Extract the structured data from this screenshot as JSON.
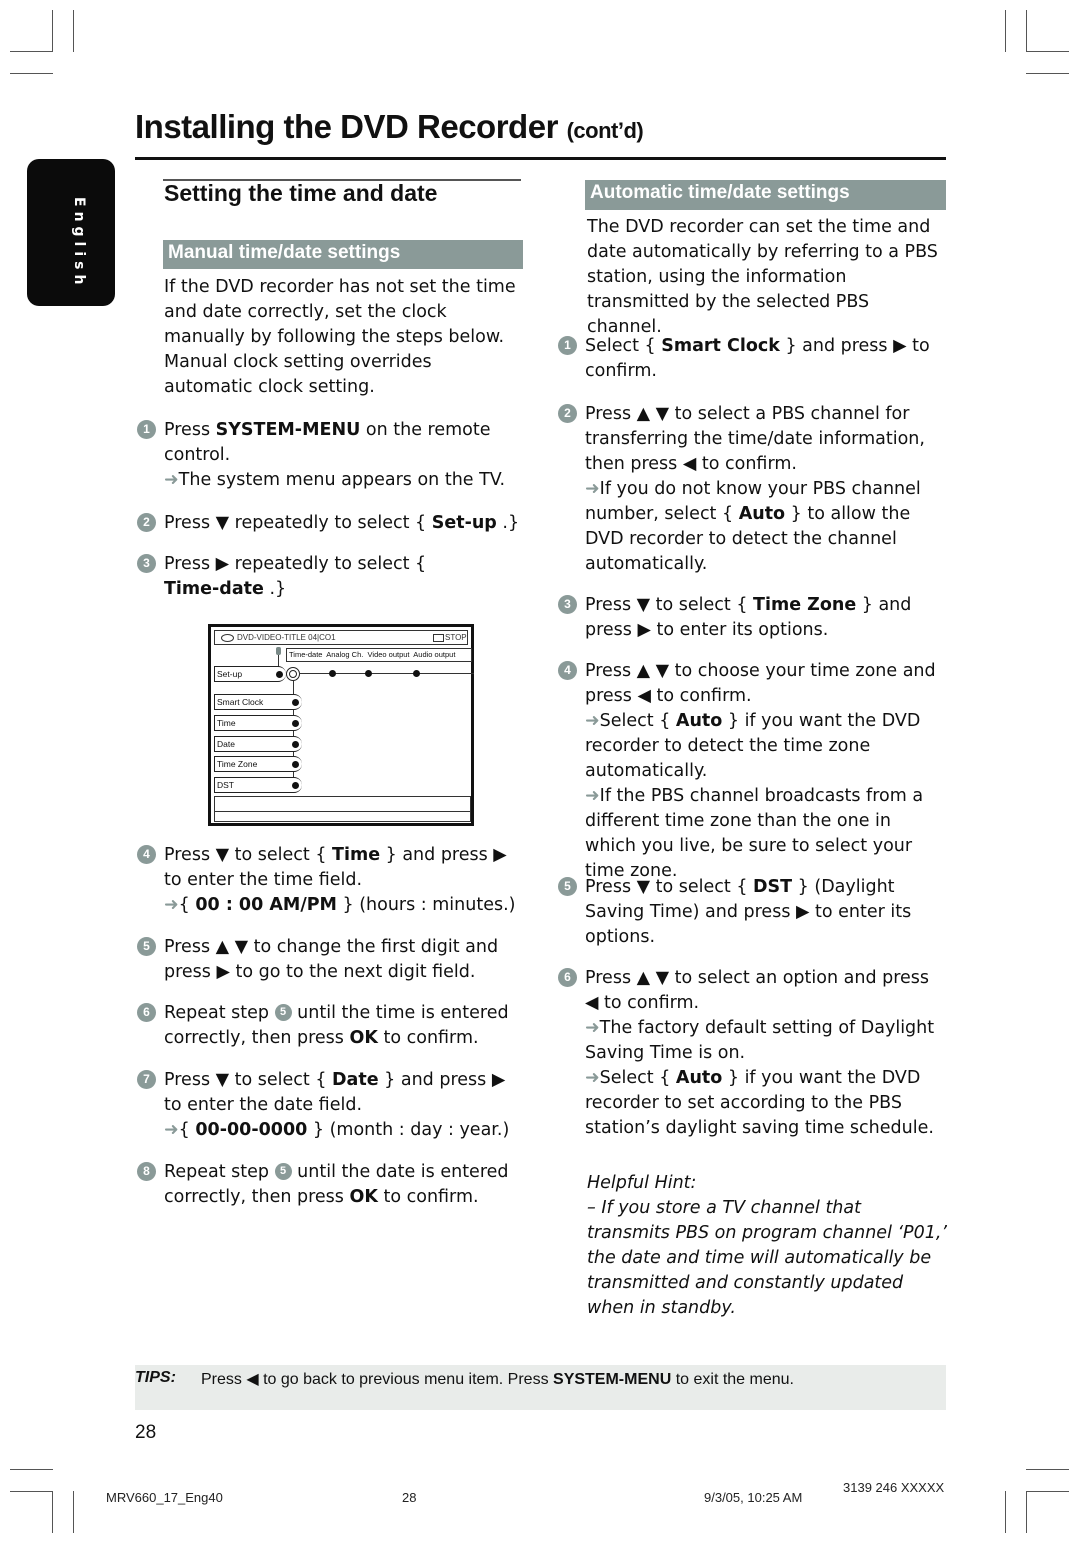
{
  "header": {
    "title": "Installing the DVD Recorder",
    "title_suffix": "(cont’d)",
    "language_tab": "English"
  },
  "left": {
    "section_title": "Setting the time and date",
    "subsection_title": "Manual time/date settings",
    "intro": "If the DVD recorder has not set the time and date correctly, set the clock manually by following the steps below. Manual clock setting overrides automatic clock setting.",
    "steps": [
      {
        "num": "1",
        "pre": "Press ",
        "bold": "SYSTEM-MENU",
        "post": " on the remote control.",
        "result": "The system menu appears on the TV."
      },
      {
        "num": "2",
        "pre": "Press ▼ repeatedly to select { ",
        "bold": "Set-up",
        "post": " .}"
      },
      {
        "num": "3",
        "pre": "Press ▶ repeatedly to select { ",
        "bold": "Time-date",
        "post": " .}"
      },
      {
        "num": "4",
        "pre": "Press ▼ to select { ",
        "bold": "Time",
        "post": " } and press ▶ to enter the time field.",
        "result_pre": "{ ",
        "result_bold": "00 : 00 AM/PM",
        "result_post": " } (hours : minutes.)"
      },
      {
        "num": "5",
        "text": "Press ▲ ▼ to change the first digit and press ▶ to go to the next digit field."
      },
      {
        "num": "6",
        "pre": "Repeat step ",
        "ref": "5",
        "mid": " until the time is entered correctly, then press ",
        "bold": "OK",
        "post": " to confirm."
      },
      {
        "num": "7",
        "pre": "Press ▼ to select { ",
        "bold": "Date",
        "post": " } and press ▶ to enter the date field.",
        "result_pre": "{ ",
        "result_bold": "00-00-0000",
        "result_post": " } (month : day : year.)"
      },
      {
        "num": "8",
        "pre": "Repeat step ",
        "ref": "5",
        "mid": " until the date is entered correctly, then press ",
        "bold": "OK",
        "post": " to confirm."
      }
    ],
    "tv_menu": {
      "status_left": "DVD-VIDEO-TITLE 04|CO1",
      "status_right": "STOP",
      "tabs": [
        "Time-date",
        "Analog Ch.",
        "Video output",
        "Audio output"
      ],
      "parent_item": "Set-up",
      "items": [
        "Smart Clock",
        "Time",
        "Date",
        "Time Zone",
        "DST"
      ]
    }
  },
  "right": {
    "subsection_title": "Automatic time/date settings",
    "intro": "The DVD recorder can set the time and date automatically by referring to a PBS station, using the information transmitted by the selected PBS channel.",
    "steps": [
      {
        "num": "1",
        "pre": "Select { ",
        "bold": "Smart Clock",
        "post": " } and press ▶ to confirm."
      },
      {
        "num": "2",
        "text": "Press ▲ ▼ to select a PBS channel for transferring the time/date information, then press ◀ to confirm.",
        "result_pre": "If you do not know your PBS channel number, select { ",
        "result_bold": "Auto",
        "result_post": " } to allow the DVD recorder to detect the channel automatically."
      },
      {
        "num": "3",
        "pre": "Press ▼ to select { ",
        "bold": "Time Zone",
        "post": " } and press ▶ to enter its options."
      },
      {
        "num": "4",
        "text": "Press ▲ ▼ to choose your time zone and press ◀ to confirm.",
        "result_pre": "Select { ",
        "result_bold": "Auto",
        "result_post": " } if you want the DVD recorder to detect the time zone automatically.",
        "result2": "If the PBS channel broadcasts from a different time zone than the one in which you live, be sure to select your time zone."
      },
      {
        "num": "5",
        "pre": "Press ▼ to select { ",
        "bold": "DST",
        "post": " } (Daylight Saving Time) and press ▶ to enter its options."
      },
      {
        "num": "6",
        "text": "Press ▲ ▼ to select an option and press ◀ to confirm.",
        "result": "The factory default setting of Daylight Saving Time is on.",
        "result2_pre": "Select { ",
        "result2_bold": "Auto",
        "result2_post": " } if you want the DVD recorder to set according to the PBS station’s daylight saving time schedule."
      }
    ],
    "hint_title": "Helpful Hint:",
    "hint_text": "–  If you store a TV channel that transmits PBS on program channel ‘P01,’ the date and time will automatically be transmitted and constantly updated when in standby."
  },
  "tips": {
    "label": "TIPS:",
    "pre": "Press ◀ to go back to previous menu item.  Press ",
    "bold": "SYSTEM-MENU",
    "post": " to exit the menu."
  },
  "page_number": "28",
  "footer": {
    "file": "MRV660_17_Eng40",
    "page": "28",
    "timestamp": "9/3/05, 10:25 AM",
    "code": "3139 246 XXXXX"
  }
}
